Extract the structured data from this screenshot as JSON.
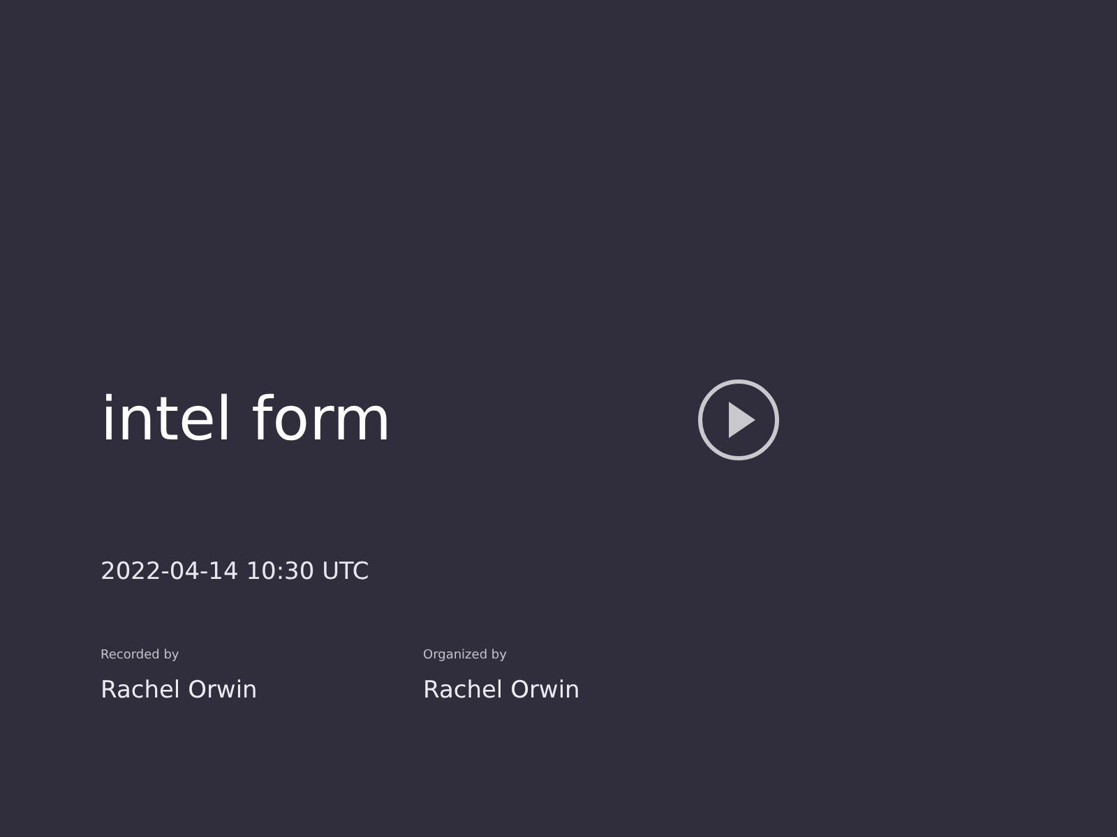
{
  "recording": {
    "title": "intel form",
    "date": "2022-04-14 10:30 UTC"
  },
  "details": [
    {
      "label": "Recorded by",
      "value": "Rachel Orwin"
    },
    {
      "label": "Organized by",
      "value": "Rachel Orwin"
    }
  ]
}
